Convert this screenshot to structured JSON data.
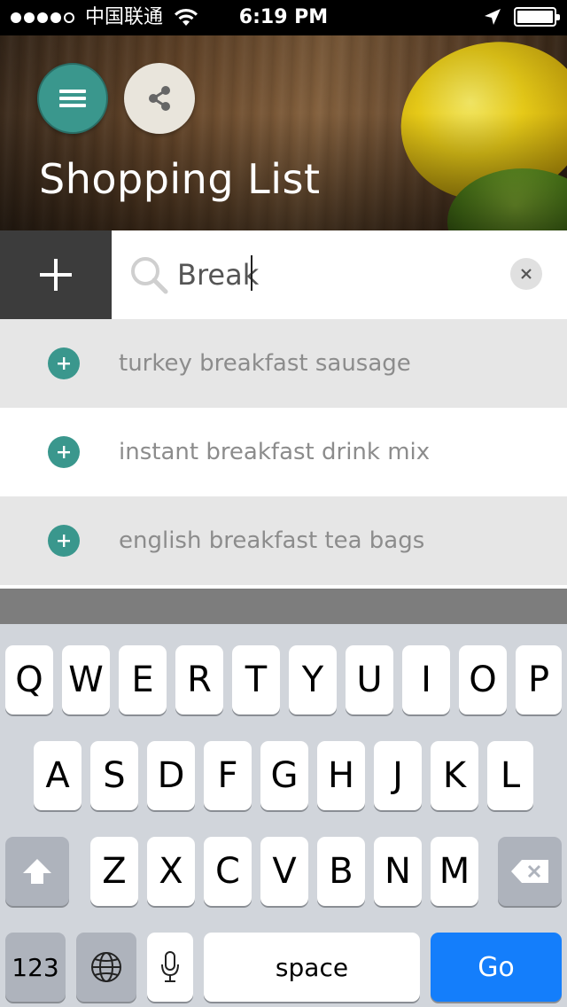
{
  "status_bar": {
    "carrier": "中国联通",
    "time": "6:19 PM"
  },
  "header": {
    "title": "Shopping List"
  },
  "search": {
    "value": "Break"
  },
  "suggestions": [
    {
      "label": "turkey breakfast sausage"
    },
    {
      "label": "instant breakfast drink mix"
    },
    {
      "label": "english breakfast tea bags"
    }
  ],
  "keyboard": {
    "row1": [
      "Q",
      "W",
      "E",
      "R",
      "T",
      "Y",
      "U",
      "I",
      "O",
      "P"
    ],
    "row2": [
      "A",
      "S",
      "D",
      "F",
      "G",
      "H",
      "J",
      "K",
      "L"
    ],
    "row3": [
      "Z",
      "X",
      "C",
      "V",
      "B",
      "N",
      "M"
    ],
    "numbers_label": "123",
    "space_label": "space",
    "go_label": "Go"
  },
  "colors": {
    "teal": "#3a978d",
    "go_blue": "#147efb",
    "suggestion_gray": "#e6e6e6"
  }
}
